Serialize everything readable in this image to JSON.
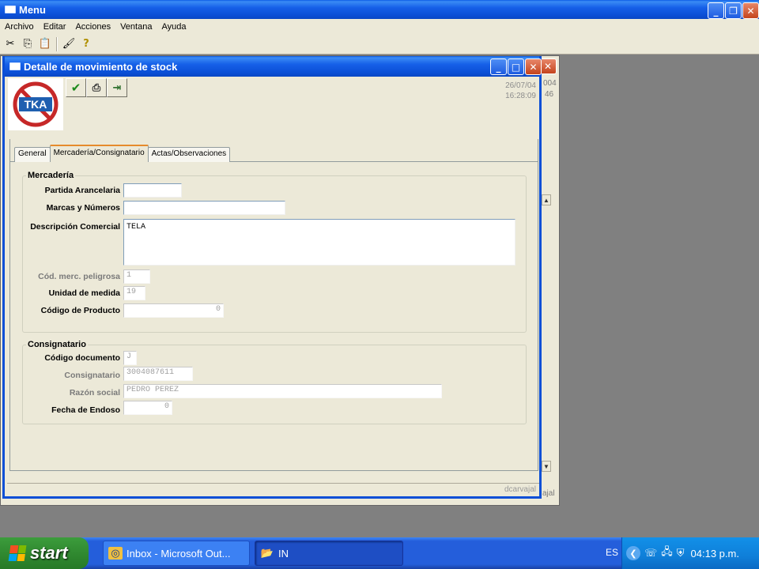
{
  "app": {
    "title": "Menu",
    "menu": [
      "Archivo",
      "Editar",
      "Acciones",
      "Ventana",
      "Ayuda"
    ]
  },
  "background_window": {
    "date_fragment": "004",
    "time_fragment": "46",
    "user_fragment": "ajal"
  },
  "dialog": {
    "title": "Detalle de movimiento de stock",
    "logo_text": "TKA",
    "date": "26/07/04",
    "time": "16:28:09",
    "tabs": [
      "General",
      "Mercadería/Consignatario",
      "Actas/Observaciones"
    ],
    "active_tab": "Mercadería/Consignatario",
    "status_user": "dcarvajal",
    "mercaderia": {
      "legend": "Mercadería",
      "partida_label": "Partida Arancelaria",
      "partida_value": "",
      "marcas_label": "Marcas y Números",
      "marcas_value": "",
      "descripcion_label": "Descripción Comercial",
      "descripcion_value": "TELA",
      "peligrosa_label": "Cód. merc. peligrosa",
      "peligrosa_value": "1",
      "unidad_label": "Unidad de medida",
      "unidad_value": "19",
      "producto_label": "Código de Producto",
      "producto_value": "0"
    },
    "consignatario": {
      "legend": "Consignatario",
      "codigo_doc_label": "Código documento",
      "codigo_doc_value": "J",
      "consignatario_label": "Consignatario",
      "consignatario_value": "3004087611",
      "razon_label": "Razón social",
      "razon_value": "PEDRO PEREZ",
      "fecha_label": "Fecha de Endoso",
      "fecha_value": "0"
    }
  },
  "taskbar": {
    "start_label": "start",
    "tasks": [
      "Inbox - Microsoft Out...",
      "IN"
    ],
    "language": "ES",
    "clock": "04:13 p.m."
  },
  "colors": {
    "xp_blue": "#0b4fd6",
    "dialog_bg": "#ece9d8",
    "desktop": "#808080",
    "start_green": "#2e862e"
  }
}
